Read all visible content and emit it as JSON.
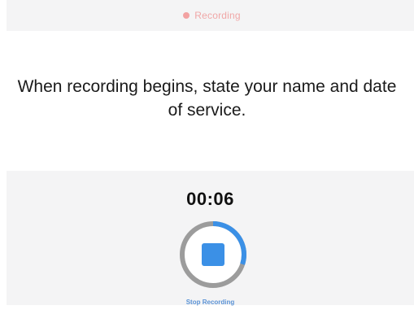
{
  "status": {
    "label": "Recording",
    "dot_color": "#f2a2a2"
  },
  "instructions": {
    "text": "When recording begins, state your name and date of service."
  },
  "recorder": {
    "timer": "00:06",
    "stop_label": "Stop Recording",
    "progress_fraction": 0.3,
    "accent_color": "#3b90e6",
    "ring_color": "#9c9c9c"
  }
}
